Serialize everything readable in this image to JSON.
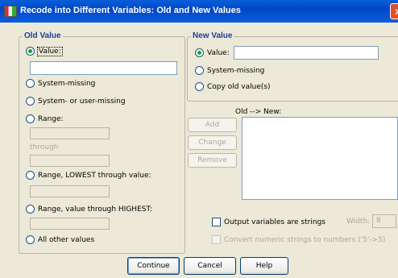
{
  "window": {
    "title": "Recode into Different Variables: Old and New Values",
    "close_glyph": "✕"
  },
  "old_value": {
    "legend": "Old Value",
    "value_label": "Value:",
    "system_missing": "System-missing",
    "system_or_user_missing": "System- or user-missing",
    "range_label": "Range:",
    "through_label": "through",
    "range_lowest": "Range, LOWEST through value:",
    "range_highest": "Range, value through HIGHEST:",
    "all_other": "All other values",
    "selected": "value"
  },
  "new_value": {
    "legend": "New Value",
    "value_label": "Value:",
    "system_missing": "System-missing",
    "copy_old": "Copy old value(s)",
    "selected": "value"
  },
  "mapping": {
    "list_label": "Old --> New:",
    "add_button": "Add",
    "change_button": "Change",
    "remove_button": "Remove"
  },
  "options": {
    "output_strings_label": "Output variables are strings",
    "width_label": "Width:",
    "width_value": "8",
    "convert_label": "Convert numeric strings to numbers ('5'->5)"
  },
  "buttons": {
    "continue": "Continue",
    "cancel": "Cancel",
    "help": "Help"
  }
}
